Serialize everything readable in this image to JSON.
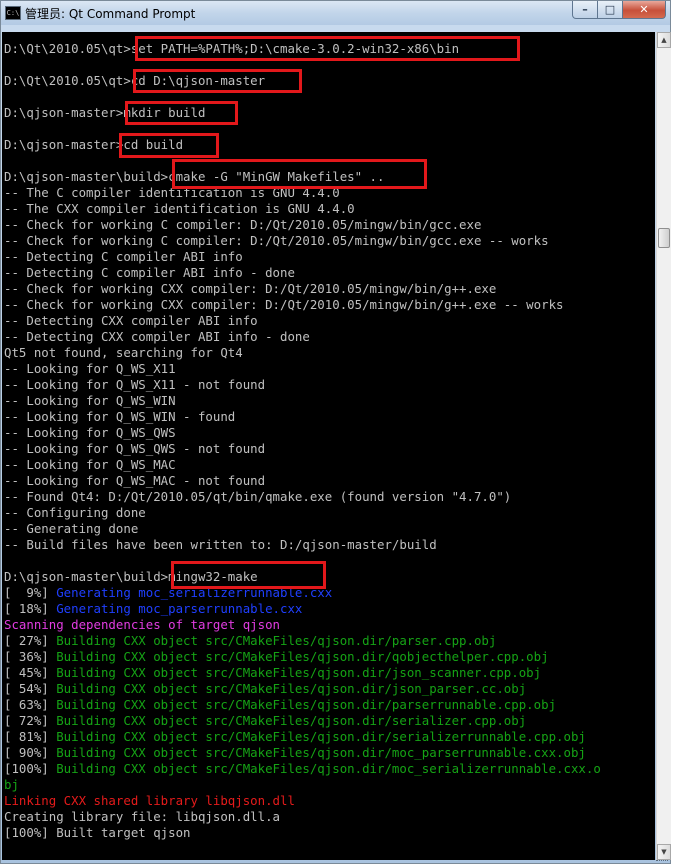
{
  "window": {
    "icon_glyph": "C:\\",
    "title": "管理员: Qt Command Prompt",
    "min_glyph": "–",
    "max_glyph": "□",
    "close_glyph": "✕"
  },
  "console_lines": [
    {
      "text": "D:\\Qt\\2010.05\\qt>set PATH=%PATH%;D:\\cmake-3.0.2-win32-x86\\bin",
      "style": "normal"
    },
    {
      "text": "",
      "style": "normal"
    },
    {
      "text": "D:\\Qt\\2010.05\\qt>cd D:\\qjson-master",
      "style": "normal"
    },
    {
      "text": "",
      "style": "normal"
    },
    {
      "text": "D:\\qjson-master>mkdir build",
      "style": "normal"
    },
    {
      "text": "",
      "style": "normal"
    },
    {
      "text": "D:\\qjson-master>cd build",
      "style": "normal"
    },
    {
      "text": "",
      "style": "normal"
    },
    {
      "text": "D:\\qjson-master\\build>cmake -G \"MinGW Makefiles\" ..",
      "style": "normal"
    },
    {
      "text": "-- The C compiler identification is GNU 4.4.0",
      "style": "normal"
    },
    {
      "text": "-- The CXX compiler identification is GNU 4.4.0",
      "style": "normal"
    },
    {
      "text": "-- Check for working C compiler: D:/Qt/2010.05/mingw/bin/gcc.exe",
      "style": "normal"
    },
    {
      "text": "-- Check for working C compiler: D:/Qt/2010.05/mingw/bin/gcc.exe -- works",
      "style": "normal"
    },
    {
      "text": "-- Detecting C compiler ABI info",
      "style": "normal"
    },
    {
      "text": "-- Detecting C compiler ABI info - done",
      "style": "normal"
    },
    {
      "text": "-- Check for working CXX compiler: D:/Qt/2010.05/mingw/bin/g++.exe",
      "style": "normal"
    },
    {
      "text": "-- Check for working CXX compiler: D:/Qt/2010.05/mingw/bin/g++.exe -- works",
      "style": "normal"
    },
    {
      "text": "-- Detecting CXX compiler ABI info",
      "style": "normal"
    },
    {
      "text": "-- Detecting CXX compiler ABI info - done",
      "style": "normal"
    },
    {
      "text": "Qt5 not found, searching for Qt4",
      "style": "normal"
    },
    {
      "text": "-- Looking for Q_WS_X11",
      "style": "normal"
    },
    {
      "text": "-- Looking for Q_WS_X11 - not found",
      "style": "normal"
    },
    {
      "text": "-- Looking for Q_WS_WIN",
      "style": "normal"
    },
    {
      "text": "-- Looking for Q_WS_WIN - found",
      "style": "normal"
    },
    {
      "text": "-- Looking for Q_WS_QWS",
      "style": "normal"
    },
    {
      "text": "-- Looking for Q_WS_QWS - not found",
      "style": "normal"
    },
    {
      "text": "-- Looking for Q_WS_MAC",
      "style": "normal"
    },
    {
      "text": "-- Looking for Q_WS_MAC - not found",
      "style": "normal"
    },
    {
      "text": "-- Found Qt4: D:/Qt/2010.05/qt/bin/qmake.exe (found version \"4.7.0\")",
      "style": "normal"
    },
    {
      "text": "-- Configuring done",
      "style": "normal"
    },
    {
      "text": "-- Generating done",
      "style": "normal"
    },
    {
      "text": "-- Build files have been written to: D:/qjson-master/build",
      "style": "normal"
    },
    {
      "text": "",
      "style": "normal"
    },
    {
      "text": "D:\\qjson-master\\build>mingw32-make",
      "style": "normal"
    },
    {
      "prefix": "[  9%] ",
      "text": "Generating moc_serializerrunnable.cxx",
      "style": "blue"
    },
    {
      "prefix": "[ 18%] ",
      "text": "Generating moc_parserrunnable.cxx",
      "style": "blue"
    },
    {
      "text": "Scanning dependencies of target qjson",
      "style": "magenta"
    },
    {
      "prefix": "[ 27%] ",
      "text": "Building CXX object src/CMakeFiles/qjson.dir/parser.cpp.obj",
      "style": "green"
    },
    {
      "prefix": "[ 36%] ",
      "text": "Building CXX object src/CMakeFiles/qjson.dir/qobjecthelper.cpp.obj",
      "style": "green"
    },
    {
      "prefix": "[ 45%] ",
      "text": "Building CXX object src/CMakeFiles/qjson.dir/json_scanner.cpp.obj",
      "style": "green"
    },
    {
      "prefix": "[ 54%] ",
      "text": "Building CXX object src/CMakeFiles/qjson.dir/json_parser.cc.obj",
      "style": "green"
    },
    {
      "prefix": "[ 63%] ",
      "text": "Building CXX object src/CMakeFiles/qjson.dir/parserrunnable.cpp.obj",
      "style": "green"
    },
    {
      "prefix": "[ 72%] ",
      "text": "Building CXX object src/CMakeFiles/qjson.dir/serializer.cpp.obj",
      "style": "green"
    },
    {
      "prefix": "[ 81%] ",
      "text": "Building CXX object src/CMakeFiles/qjson.dir/serializerrunnable.cpp.obj",
      "style": "green"
    },
    {
      "prefix": "[ 90%] ",
      "text": "Building CXX object src/CMakeFiles/qjson.dir/moc_parserrunnable.cxx.obj",
      "style": "green"
    },
    {
      "prefix": "[100%] ",
      "text": "Building CXX object src/CMakeFiles/qjson.dir/moc_serializerrunnable.cxx.o",
      "style": "green"
    },
    {
      "text": "bj",
      "style": "green"
    },
    {
      "text": "Linking CXX shared library libqjson.dll",
      "style": "red"
    },
    {
      "text": "Creating library file: libqjson.dll.a",
      "style": "normal"
    },
    {
      "text": "[100%] Built target qjson",
      "style": "normal"
    }
  ],
  "colors": {
    "console_bg": "#000000",
    "console_text": "#c0c0c0",
    "generating": "#1f3fff",
    "building": "#15a315",
    "scanning": "#e13ce1",
    "linking": "#e51b1b",
    "highlight_box": "#e2181b"
  },
  "icons": {
    "window_icon": "cmd-icon",
    "scroll_up": "▲",
    "scroll_down": "▼"
  }
}
